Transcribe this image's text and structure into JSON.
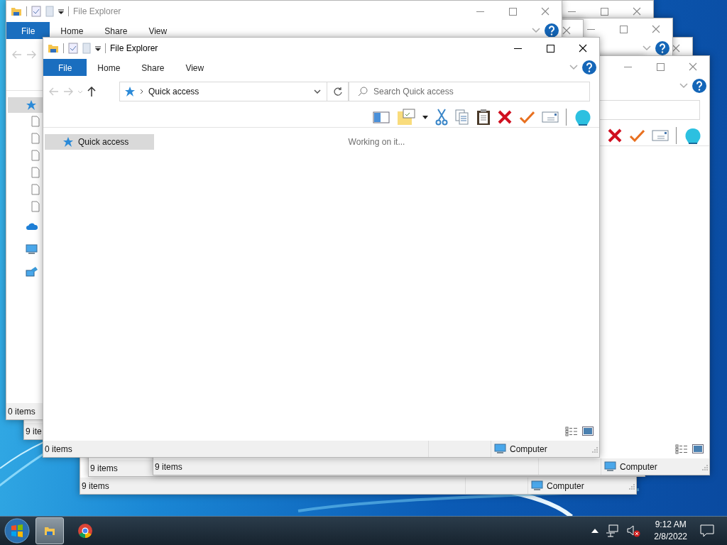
{
  "windows": [
    {
      "title_bar": {
        "title": "File Explorer",
        "active": true,
        "controls": [
          {
            "kind": "minimize"
          },
          {
            "kind": "maximize"
          },
          {
            "kind": "close"
          }
        ]
      },
      "ribbon": {
        "tabs": [
          {
            "kind": "menu",
            "label": "File",
            "selected": false
          },
          {
            "kind": "tab",
            "label": "Home",
            "selected": false
          },
          {
            "kind": "tab",
            "label": "Share",
            "selected": false
          },
          {
            "kind": "tab",
            "label": "View",
            "selected": false
          }
        ],
        "buttons": [
          {
            "kind": "chevron"
          },
          {
            "kind": "help"
          }
        ]
      },
      "nav_buttons": [
        {
          "kind": "back",
          "disabled": true
        },
        {
          "kind": "forward",
          "disabled": true
        },
        {
          "kind": "recent",
          "disabled": true
        },
        {
          "kind": "up",
          "disabled": false
        }
      ],
      "address_bar": {
        "location": "Quick access"
      },
      "search": {
        "kind": "field",
        "placeholder": "Search Quick access"
      },
      "toolbar": [
        {
          "kind": "pane"
        },
        {
          "kind": "folder-options"
        },
        {
          "kind": "cut"
        },
        {
          "kind": "copy"
        },
        {
          "kind": "paste"
        },
        {
          "kind": "delete"
        },
        {
          "kind": "accept"
        },
        {
          "kind": "mail"
        },
        {
          "kind": "separator"
        },
        {
          "kind": "shell"
        }
      ],
      "navigation_pane": [
        {
          "kind": "quick-access",
          "label": "Quick access",
          "selected": true
        }
      ],
      "content": {
        "message": "Working on it..."
      },
      "view_buttons": [
        {
          "kind": "details"
        },
        {
          "kind": "large-icons"
        }
      ],
      "status_bar": {
        "item_count": "0 items",
        "location": "Computer"
      }
    },
    {
      "title_bar": {
        "title": "File Explorer",
        "active": false,
        "controls": [
          {
            "kind": "minimize"
          },
          {
            "kind": "maximize"
          },
          {
            "kind": "close"
          }
        ]
      },
      "ribbon": {
        "tabs": [
          {
            "kind": "menu",
            "label": "File",
            "selected": false
          },
          {
            "kind": "tab",
            "label": "Home",
            "selected": false
          },
          {
            "kind": "tab",
            "label": "Share",
            "selected": false
          },
          {
            "kind": "tab",
            "label": "View",
            "selected": false
          }
        ],
        "buttons": [
          {
            "kind": "chevron"
          },
          {
            "kind": "help"
          }
        ]
      },
      "nav_buttons": [
        {
          "kind": "back",
          "disabled": true
        },
        {
          "kind": "forward",
          "disabled": true
        }
      ],
      "navigation_pane": [
        {
          "kind": "quick-access",
          "selected": true,
          "children": [
            {
              "kind": "file"
            },
            {
              "kind": "file"
            },
            {
              "kind": "file"
            },
            {
              "kind": "file"
            },
            {
              "kind": "file"
            },
            {
              "kind": "file"
            }
          ]
        },
        {
          "kind": "cloud",
          "selected": false
        },
        {
          "kind": "computer",
          "selected": false
        },
        {
          "kind": "network",
          "selected": false
        }
      ],
      "status_bar": {
        "item_count": "0 items"
      }
    },
    {
      "title_bar": {
        "controls": [
          {
            "kind": "minimize"
          },
          {
            "kind": "maximize"
          },
          {
            "kind": "close"
          }
        ]
      },
      "ribbon": {
        "buttons": [
          {
            "kind": "chevron"
          },
          {
            "kind": "help"
          }
        ]
      },
      "search": {
        "kind": "field"
      },
      "toolbar": [
        {
          "kind": "delete"
        },
        {
          "kind": "accept"
        },
        {
          "kind": "mail"
        },
        {
          "kind": "separator"
        },
        {
          "kind": "shell"
        }
      ],
      "view_buttons": [
        {
          "kind": "details"
        },
        {
          "kind": "large-icons"
        }
      ],
      "status_bar": {
        "item_count": "9 items",
        "location": "Computer"
      }
    },
    {
      "status_bar": {
        "item_count": "9 ite"
      }
    },
    {
      "status_bar": {
        "item_count": "9 items"
      }
    },
    {
      "status_bar": {
        "item_count": "9 items",
        "location": "Computer"
      }
    },
    {
      "title_bar": {
        "controls": [
          {
            "kind": "close"
          }
        ]
      }
    },
    {
      "title_bar": {
        "controls": [
          {
            "kind": "minimize"
          },
          {
            "kind": "maximize"
          },
          {
            "kind": "close"
          }
        ]
      },
      "ribbon": {
        "buttons": [
          {
            "kind": "chevron"
          },
          {
            "kind": "help"
          }
        ]
      }
    },
    {
      "title_bar": {
        "controls": [
          {
            "kind": "close"
          }
        ]
      }
    },
    {
      "title_bar": {
        "controls": [
          {
            "kind": "minimize"
          },
          {
            "kind": "maximize"
          },
          {
            "kind": "close"
          }
        ]
      }
    }
  ],
  "taskbar": {
    "apps": [
      {
        "kind": "file-explorer",
        "selected": true
      },
      {
        "kind": "browser",
        "selected": false
      }
    ],
    "tray": {
      "volume_muted": true,
      "time": "9:12 AM",
      "date": "2/8/2022"
    }
  }
}
